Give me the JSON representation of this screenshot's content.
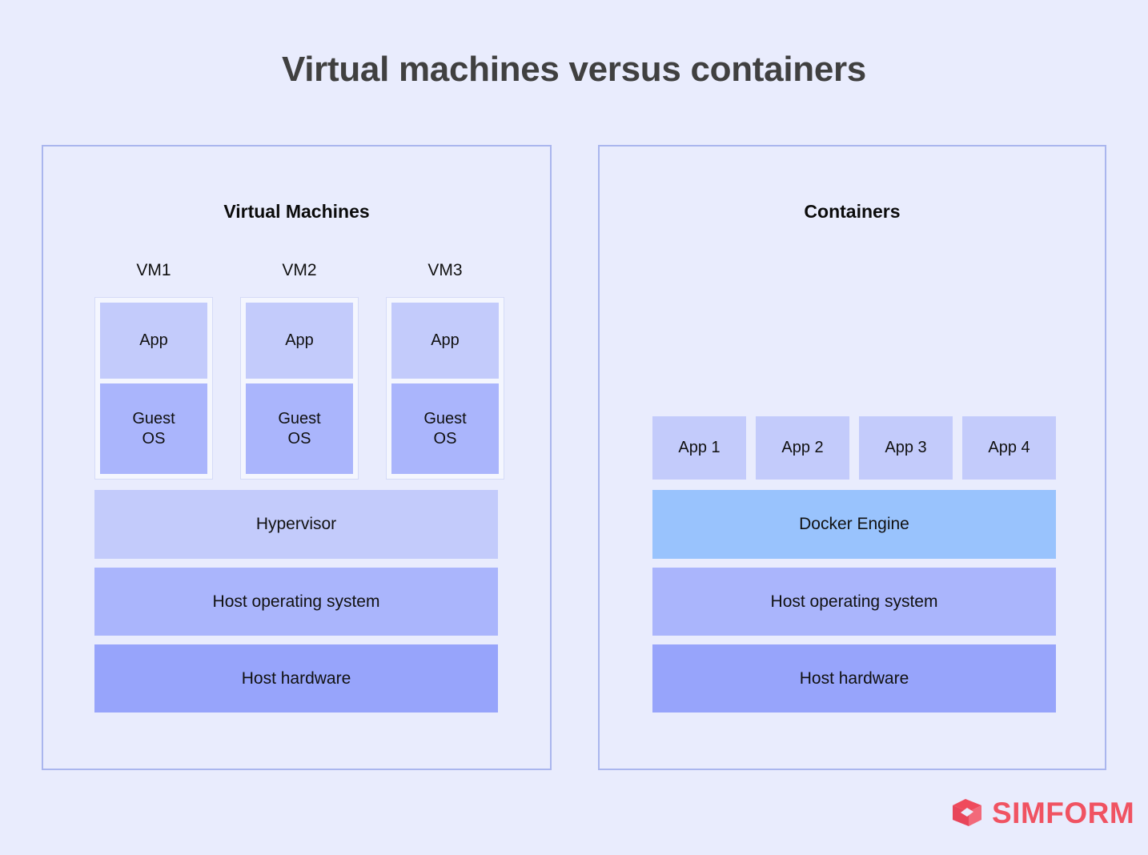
{
  "title": "Virtual machines versus containers",
  "colors": {
    "background": "#e9ecfd",
    "panel_border": "#aab6ee",
    "app_box": "#c3cbfb",
    "guest_os": "#aab5fc",
    "hypervisor": "#c3cbfb",
    "docker_engine": "#99c3fd",
    "host_os": "#aab5fc",
    "host_hardware": "#97a4fb",
    "title_text": "#404040",
    "brand": "#f05362"
  },
  "left_panel": {
    "heading": "Virtual Machines",
    "vms": [
      {
        "label": "VM1",
        "app": "App",
        "guest_os": "Guest\nOS"
      },
      {
        "label": "VM2",
        "app": "App",
        "guest_os": "Guest\nOS"
      },
      {
        "label": "VM3",
        "app": "App",
        "guest_os": "Guest\nOS"
      }
    ],
    "stack": [
      {
        "label": "Hypervisor"
      },
      {
        "label": "Host operating system"
      },
      {
        "label": "Host hardware"
      }
    ]
  },
  "right_panel": {
    "heading": "Containers",
    "apps": [
      {
        "label": "App 1"
      },
      {
        "label": "App 2"
      },
      {
        "label": "App 3"
      },
      {
        "label": "App 4"
      }
    ],
    "stack": [
      {
        "label": "Docker Engine"
      },
      {
        "label": "Host operating system"
      },
      {
        "label": "Host hardware"
      }
    ]
  },
  "footer": {
    "brand_name": "SIMFORM",
    "brand_mark": "simform-cube-icon"
  }
}
